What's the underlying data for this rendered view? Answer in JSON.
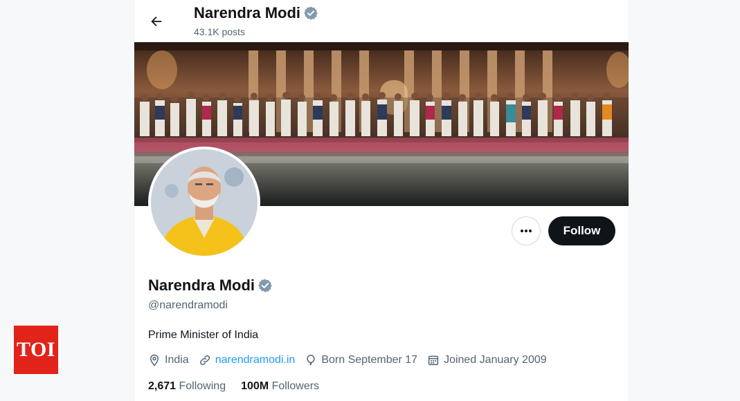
{
  "watermark": {
    "logo_text": "TOI"
  },
  "header": {
    "name": "Narendra Modi",
    "posts": "43.1K posts",
    "icons": {
      "back": "arrow-left-icon",
      "verified": "verified-badge-icon"
    }
  },
  "profile": {
    "name": "Narendra Modi",
    "handle": "@narendramodi",
    "bio": "Prime Minister of India",
    "location": "India",
    "website": "narendramodi.in",
    "birthday": "Born September 17",
    "joined": "Joined January 2009",
    "following_count": "2,671",
    "following_label": "Following",
    "followers_count": "100M",
    "followers_label": "Followers"
  },
  "actions": {
    "more": "more-options-icon",
    "follow_label": "Follow"
  },
  "colors": {
    "accent": "#1d9bf0",
    "verified": "#829aab",
    "text_primary": "#0f1419",
    "text_secondary": "#536471",
    "follow_bg": "#0f1419",
    "toi_red": "#e2231a"
  }
}
